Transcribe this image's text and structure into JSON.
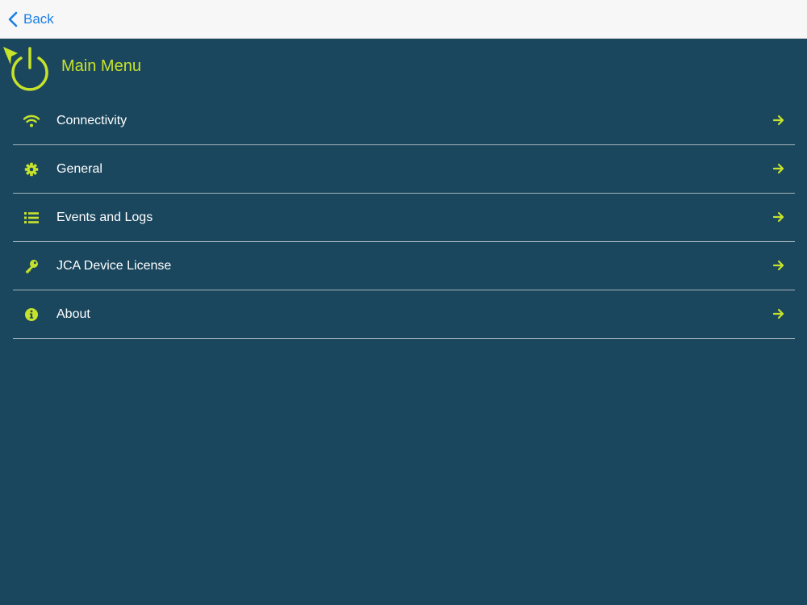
{
  "navbar": {
    "back_label": "Back",
    "back_icon": "chevron-left-icon"
  },
  "header": {
    "title": "Main Menu",
    "logo_icon": "power-icon"
  },
  "colors": {
    "accent": "#c6e22b",
    "background": "#1b475e",
    "navbar": "#f7f7f7",
    "link": "#1a7ee6",
    "divider": "#a7b5bd"
  },
  "menu": {
    "items": [
      {
        "label": "Connectivity",
        "icon": "wifi-icon"
      },
      {
        "label": "General",
        "icon": "gear-icon"
      },
      {
        "label": "Events and Logs",
        "icon": "list-icon"
      },
      {
        "label": "JCA Device License",
        "icon": "key-icon"
      },
      {
        "label": "About",
        "icon": "info-icon"
      }
    ]
  }
}
